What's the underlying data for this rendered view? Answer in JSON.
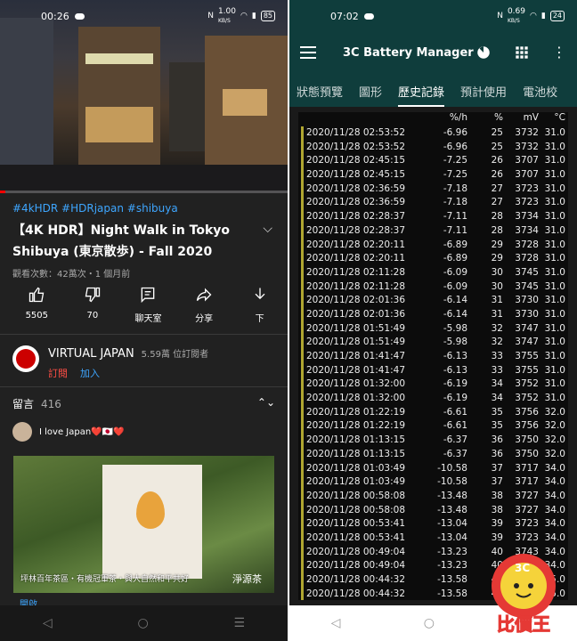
{
  "left": {
    "status": {
      "time": "00:26",
      "speed": "1.00",
      "speed_unit": "KB/S",
      "battery": "85"
    },
    "video": {
      "progress_fraction": 0.02
    },
    "hashtags": "#4kHDR #HDRjapan #shibuya",
    "title": "【4K HDR】Night Walk in Tokyo Shibuya (東京散歩) - Fall 2020",
    "meta": "觀看次數：42萬次・1 個月前",
    "actions": [
      {
        "icon": "like-icon",
        "label": "5505"
      },
      {
        "icon": "dislike-icon",
        "label": "70"
      },
      {
        "icon": "chat-icon",
        "label": "聊天室"
      },
      {
        "icon": "share-icon",
        "label": "分享"
      },
      {
        "icon": "download-icon",
        "label": "下"
      }
    ],
    "channel": {
      "name": "VIRTUAL JAPAN",
      "subs": "5.59萬 位訂閱者",
      "subscribe": "訂閱",
      "join": "加入"
    },
    "comments": {
      "label": "留言",
      "count": "416",
      "top_comment": "I love Japan❤️🇯🇵❤️"
    },
    "ad": {
      "caption": "坪林百年茶區・有機冠軍茶・與大自然和平共好",
      "logo": "淨源茶",
      "footer": "開啟"
    }
  },
  "right": {
    "status": {
      "time": "07:02",
      "speed": "0.69",
      "speed_unit": "KB/S",
      "battery": "24"
    },
    "app_title": "3C Battery Manager",
    "tabs": [
      "狀態預覽",
      "圖形",
      "歷史記錄",
      "預計使用",
      "電池校"
    ],
    "active_tab": 2,
    "columns": [
      "",
      "%/h",
      "%",
      "mV",
      "°C"
    ],
    "rows": [
      [
        "2020/11/28 02:53:52",
        "-6.96",
        "25",
        "3732",
        "31.0"
      ],
      [
        "2020/11/28 02:53:52",
        "-6.96",
        "25",
        "3732",
        "31.0"
      ],
      [
        "2020/11/28 02:45:15",
        "-7.25",
        "26",
        "3707",
        "31.0"
      ],
      [
        "2020/11/28 02:45:15",
        "-7.25",
        "26",
        "3707",
        "31.0"
      ],
      [
        "2020/11/28 02:36:59",
        "-7.18",
        "27",
        "3723",
        "31.0"
      ],
      [
        "2020/11/28 02:36:59",
        "-7.18",
        "27",
        "3723",
        "31.0"
      ],
      [
        "2020/11/28 02:28:37",
        "-7.11",
        "28",
        "3734",
        "31.0"
      ],
      [
        "2020/11/28 02:28:37",
        "-7.11",
        "28",
        "3734",
        "31.0"
      ],
      [
        "2020/11/28 02:20:11",
        "-6.89",
        "29",
        "3728",
        "31.0"
      ],
      [
        "2020/11/28 02:20:11",
        "-6.89",
        "29",
        "3728",
        "31.0"
      ],
      [
        "2020/11/28 02:11:28",
        "-6.09",
        "30",
        "3745",
        "31.0"
      ],
      [
        "2020/11/28 02:11:28",
        "-6.09",
        "30",
        "3745",
        "31.0"
      ],
      [
        "2020/11/28 02:01:36",
        "-6.14",
        "31",
        "3730",
        "31.0"
      ],
      [
        "2020/11/28 02:01:36",
        "-6.14",
        "31",
        "3730",
        "31.0"
      ],
      [
        "2020/11/28 01:51:49",
        "-5.98",
        "32",
        "3747",
        "31.0"
      ],
      [
        "2020/11/28 01:51:49",
        "-5.98",
        "32",
        "3747",
        "31.0"
      ],
      [
        "2020/11/28 01:41:47",
        "-6.13",
        "33",
        "3755",
        "31.0"
      ],
      [
        "2020/11/28 01:41:47",
        "-6.13",
        "33",
        "3755",
        "31.0"
      ],
      [
        "2020/11/28 01:32:00",
        "-6.19",
        "34",
        "3752",
        "31.0"
      ],
      [
        "2020/11/28 01:32:00",
        "-6.19",
        "34",
        "3752",
        "31.0"
      ],
      [
        "2020/11/28 01:22:19",
        "-6.61",
        "35",
        "3756",
        "32.0"
      ],
      [
        "2020/11/28 01:22:19",
        "-6.61",
        "35",
        "3756",
        "32.0"
      ],
      [
        "2020/11/28 01:13:15",
        "-6.37",
        "36",
        "3750",
        "32.0"
      ],
      [
        "2020/11/28 01:13:15",
        "-6.37",
        "36",
        "3750",
        "32.0"
      ],
      [
        "2020/11/28 01:03:49",
        "-10.58",
        "37",
        "3717",
        "34.0"
      ],
      [
        "2020/11/28 01:03:49",
        "-10.58",
        "37",
        "3717",
        "34.0"
      ],
      [
        "2020/11/28 00:58:08",
        "-13.48",
        "38",
        "3727",
        "34.0"
      ],
      [
        "2020/11/28 00:58:08",
        "-13.48",
        "38",
        "3727",
        "34.0"
      ],
      [
        "2020/11/28 00:53:41",
        "-13.04",
        "39",
        "3723",
        "34.0"
      ],
      [
        "2020/11/28 00:53:41",
        "-13.04",
        "39",
        "3723",
        "34.0"
      ],
      [
        "2020/11/28 00:49:04",
        "-13.23",
        "40",
        "3743",
        "34.0"
      ],
      [
        "2020/11/28 00:49:04",
        "-13.23",
        "40",
        "3743",
        "34.0"
      ],
      [
        "2020/11/28 00:44:32",
        "-13.58",
        "41",
        "3745",
        "35.0"
      ],
      [
        "2020/11/28 00:44:32",
        "-13.58",
        "41",
        "3745",
        "35.0"
      ]
    ]
  },
  "watermark": {
    "text": "比價王",
    "letters": "3C"
  }
}
